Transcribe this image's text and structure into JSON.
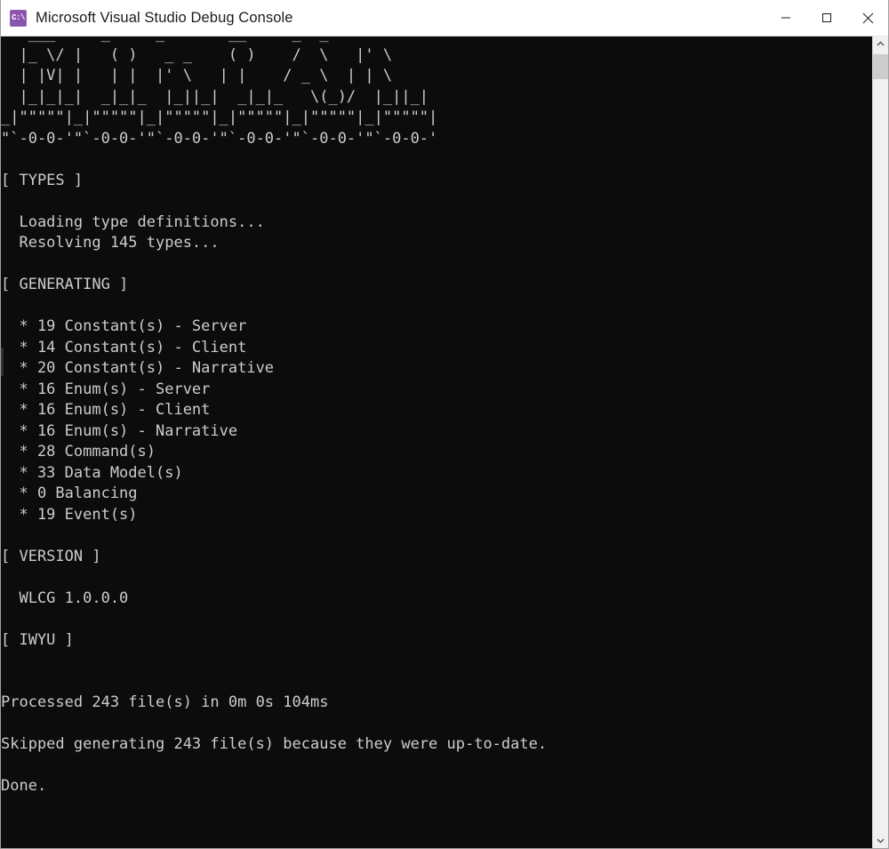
{
  "window": {
    "title": "Microsoft Visual Studio Debug Console",
    "app_icon": "console-icon",
    "app_icon_text": "C:\\",
    "controls": {
      "minimize": "minimize-button",
      "maximize": "maximize-button",
      "close": "close-button"
    },
    "colors": {
      "titlebar_bg": "#ffffff",
      "title_fg": "#1b1b1b",
      "console_bg": "#0c0c0c",
      "console_fg": "#cccccc",
      "icon_accent": "#8a56ac",
      "scrollbar_track": "#f0f0f0",
      "scrollbar_thumb": "#cdcdcd"
    }
  },
  "console": {
    "banner": " ___     _     _      __    _  _  \n|_ \\/ | ( )   _ _   ( )   /  \\  |' \\ \n| |V| | | |  |' \\  | |   / _ \\ | | \\\n|_|_|_| |_|_  |_||_|  |_|_|  \\(_)/ |_||_|\n_|\"\"\"\"\"|_|\"\"\"\"\"|_|\"\"\"\"\"|_|\"\"\"\"\"|_|\"\"\"\"\"|_|\"\"\"\"\"|\n\"`-0-0-'\"`-0-0-'\"`-0-0-'\"`-0-0-'\"`-0-0-'\"`-0-0-'",
    "sections": [
      {
        "header": "[ TYPES ]",
        "lines": [
          "  Loading type definitions...",
          "  Resolving 145 types..."
        ]
      },
      {
        "header": "[ GENERATING ]",
        "lines": [
          "  * 19 Constant(s) - Server",
          "  * 14 Constant(s) - Client",
          "  * 20 Constant(s) - Narrative",
          "  * 16 Enum(s) - Server",
          "  * 16 Enum(s) - Client",
          "  * 16 Enum(s) - Narrative",
          "  * 28 Command(s)",
          "  * 33 Data Model(s)",
          "  * 0 Balancing",
          "  * 19 Event(s)"
        ]
      },
      {
        "header": "[ VERSION ]",
        "lines": [
          "  WLCG 1.0.0.0"
        ]
      },
      {
        "header": "[ IWYU ]",
        "lines": []
      }
    ],
    "footer": [
      "Processed 243 file(s) in 0m 0s 104ms",
      "",
      "Skipped generating 243 file(s) because they were up-to-date.",
      "",
      "Done."
    ],
    "full_text": "   ___     _     _       __     _  _  \n  |_ \\/ |   ( )   _ _    ( )    /  \\   |' \\ \n  | |V| |   | |  |' \\   | |    / _ \\  | | \\\n  |_|_|_|  _|_|_  |_||_|  _|_|_   \\(_)/  |_||_|\n_|\"\"\"\"\"|_|\"\"\"\"\"|_|\"\"\"\"\"|_|\"\"\"\"\"|_|\"\"\"\"\"|_|\"\"\"\"\"|\n\"`-0-0-'\"`-0-0-'\"`-0-0-'\"`-0-0-'\"`-0-0-'\"`-0-0-'\n\n[ TYPES ]\n\n  Loading type definitions...\n  Resolving 145 types...\n\n[ GENERATING ]\n\n  * 19 Constant(s) - Server\n  * 14 Constant(s) - Client\n  * 20 Constant(s) - Narrative\n  * 16 Enum(s) - Server\n  * 16 Enum(s) - Client\n  * 16 Enum(s) - Narrative\n  * 28 Command(s)\n  * 33 Data Model(s)\n  * 0 Balancing\n  * 19 Event(s)\n\n[ VERSION ]\n\n  WLCG 1.0.0.0\n\n[ IWYU ]\n\n\nProcessed 243 file(s) in 0m 0s 104ms\n\nSkipped generating 243 file(s) because they were up-to-date.\n\nDone."
  },
  "scrollbar": {
    "up_arrow": "chevron-up-icon",
    "down_arrow": "chevron-down-icon",
    "thumb": "scrollbar-thumb"
  }
}
